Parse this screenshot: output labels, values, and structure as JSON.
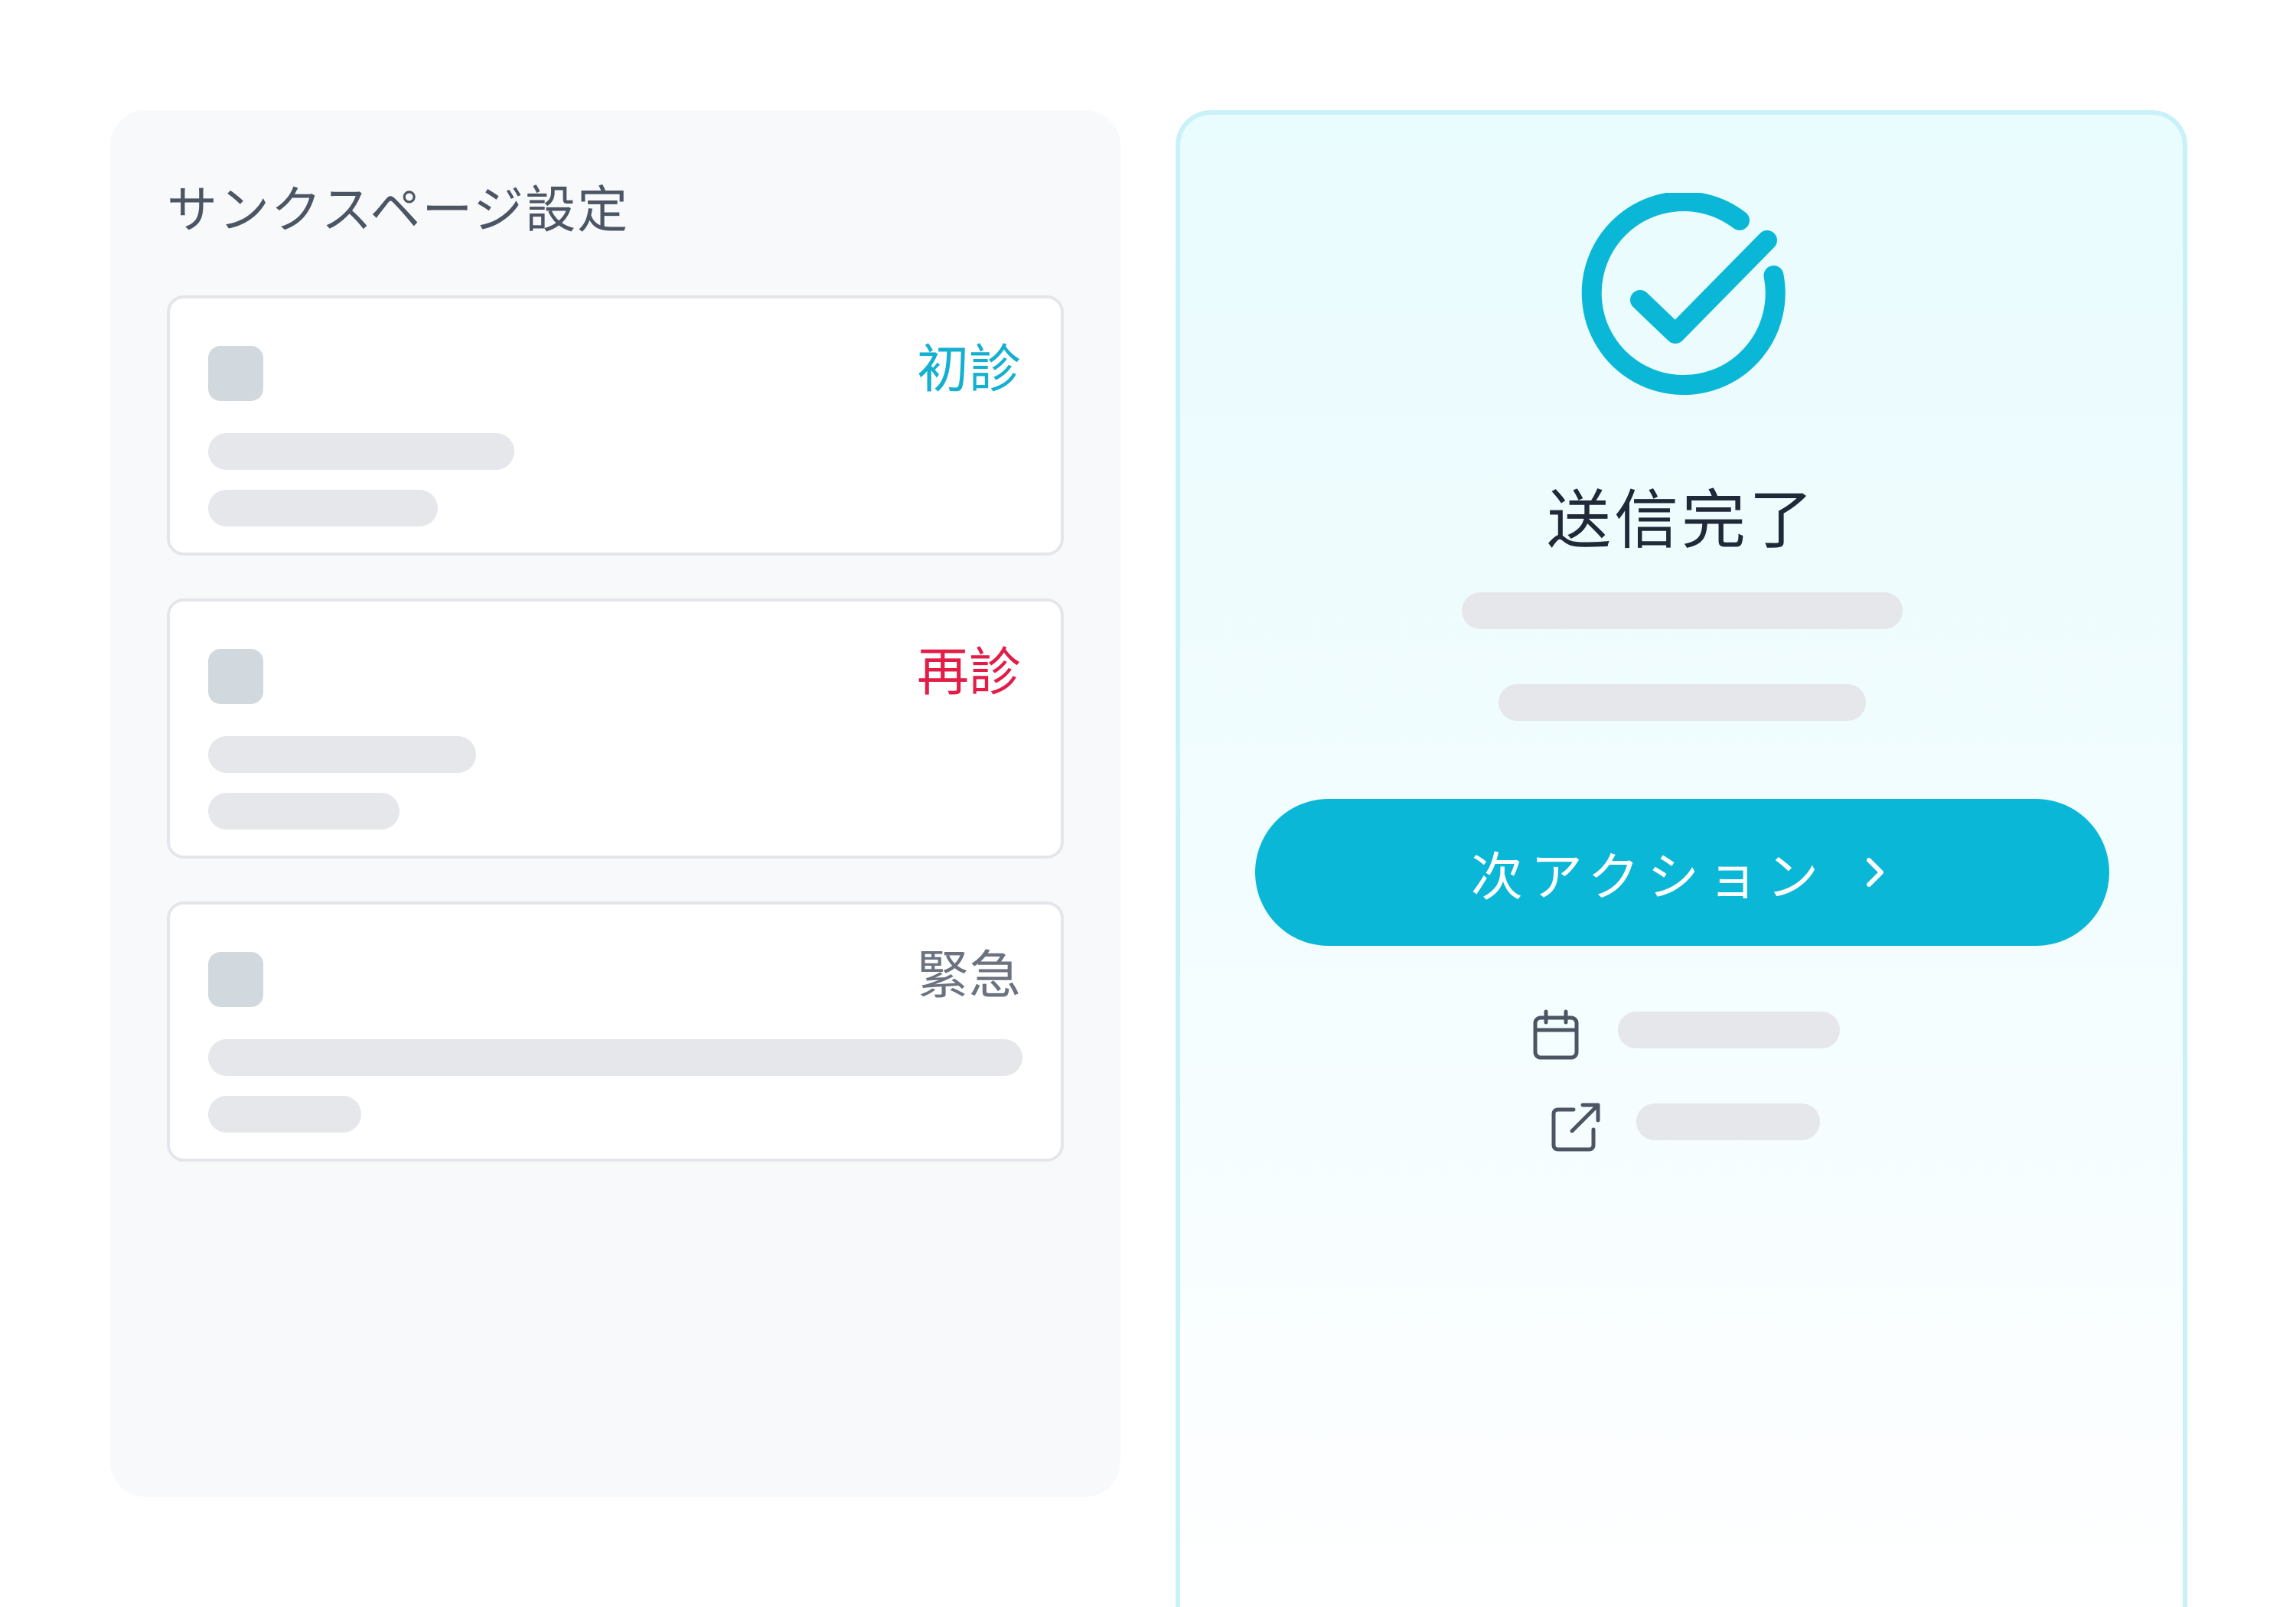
{
  "settings": {
    "title": "サンクスページ設定",
    "variants": [
      {
        "label": "初診",
        "color": "#14b0cf"
      },
      {
        "label": "再診",
        "color": "#e11d48"
      },
      {
        "label": "緊急",
        "color": "#6b7280"
      }
    ]
  },
  "preview": {
    "icon": "check-circle-icon",
    "title": "送信完了",
    "button": {
      "label": "次アクション",
      "icon": "chevron-right-icon"
    },
    "meta": [
      {
        "icon": "calendar-icon"
      },
      {
        "icon": "external-link-icon"
      }
    ]
  },
  "colors": {
    "accent": "#0bb7d6",
    "accent_border": "#c9f1f8",
    "panel_bg": "#f8f9fb",
    "skeleton": "#e5e7ea"
  }
}
